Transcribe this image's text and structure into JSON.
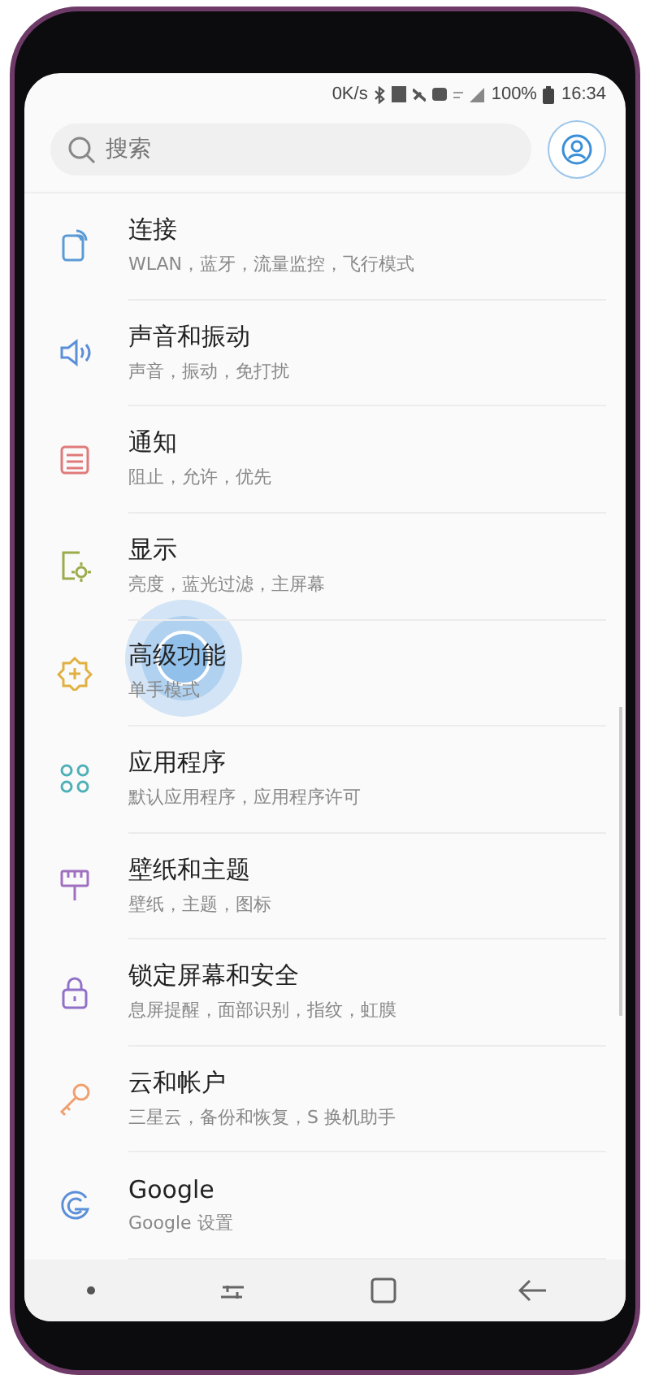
{
  "status_bar": {
    "speed": "0K/s",
    "battery": "100%",
    "time": "16:34"
  },
  "search": {
    "placeholder": "搜索"
  },
  "settings": [
    {
      "title": "连接",
      "subtitle": "WLAN，蓝牙，流量监控，飞行模式",
      "color": "#5b9bd5"
    },
    {
      "title": "声音和振动",
      "subtitle": "声音，振动，免打扰",
      "color": "#5b8fd8"
    },
    {
      "title": "通知",
      "subtitle": "阻止，允许，优先",
      "color": "#e07a7a"
    },
    {
      "title": "显示",
      "subtitle": "亮度，蓝光过滤，主屏幕",
      "color": "#9aab4a"
    },
    {
      "title": "高级功能",
      "subtitle": "单手模式",
      "color": "#e0b040"
    },
    {
      "title": "应用程序",
      "subtitle": "默认应用程序，应用程序许可",
      "color": "#4fb0b8"
    },
    {
      "title": "壁纸和主题",
      "subtitle": "壁纸，主题，图标",
      "color": "#a070c0"
    },
    {
      "title": "锁定屏幕和安全",
      "subtitle": "息屏提醒，面部识别，指纹，虹膜",
      "color": "#9070c8"
    },
    {
      "title": "云和帐户",
      "subtitle": "三星云，备份和恢复，S 换机助手",
      "color": "#f0a070"
    },
    {
      "title": "Google",
      "subtitle": "Google 设置",
      "color": "#5b8fd8"
    }
  ]
}
